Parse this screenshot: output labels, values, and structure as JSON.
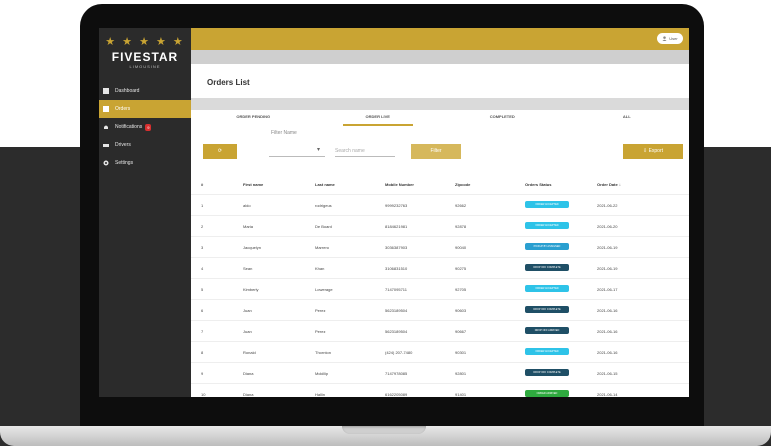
{
  "brand": {
    "stars": "★ ★ ★ ★ ★",
    "name": "FIVESTAR",
    "subtitle": "LIMOUSINE"
  },
  "sidebar": {
    "items": [
      {
        "label": "Dashboard",
        "icon": "grid-icon"
      },
      {
        "label": "Orders",
        "icon": "list-icon"
      },
      {
        "label": "Notifications",
        "icon": "bell-icon",
        "badge": "9"
      },
      {
        "label": "Drivers",
        "icon": "car-icon"
      },
      {
        "label": "Settings",
        "icon": "gear-icon"
      }
    ],
    "active_index": 1
  },
  "topbar": {
    "user_label": "User"
  },
  "page": {
    "title": "Orders List"
  },
  "tabs": [
    "ORDER PENDING",
    "ORDER LIVE",
    "COMPLETED",
    "ALL"
  ],
  "active_tab": 1,
  "filters": {
    "filter_label": "Filter Name",
    "search_placeholder": "Search name",
    "filter_button": "Filter",
    "export_button": "Export"
  },
  "table": {
    "headers": [
      "#",
      "First name",
      "Last name",
      "Mobile Number",
      "Zipcode",
      "Orders Status",
      "Order Date"
    ],
    "rows": [
      {
        "n": "1",
        "first": "aldo",
        "last": "rodrigeus",
        "mobile": "9999232763",
        "zip": "92662",
        "status": "ORDER ACCEPTED",
        "status_color": "#2ec3e8",
        "date": "2021-06-22"
      },
      {
        "n": "2",
        "first": "Maria",
        "last": "De Board",
        "mobile": "8184621981",
        "zip": "92878",
        "status": "ORDER ACCEPTED",
        "status_color": "#2ec3e8",
        "date": "2021-06-20"
      },
      {
        "n": "3",
        "first": "Jacquelyn",
        "last": "Marrero",
        "mobile": "3036387903",
        "zip": "90040",
        "status": "PICKUP BY ASSIGNED",
        "status_color": "#2a9fd0",
        "date": "2021-06-19"
      },
      {
        "n": "4",
        "first": "Sean",
        "last": "Khan",
        "mobile": "3106831510",
        "zip": "90275",
        "status": "DROP OFF COMPLETE",
        "status_color": "#1f4f66",
        "date": "2021-06-19"
      },
      {
        "n": "5",
        "first": "Kimberly",
        "last": "Lowerage",
        "mobile": "7147095711",
        "zip": "92705",
        "status": "ORDER ACCEPTED",
        "status_color": "#2ec3e8",
        "date": "2021-06-17"
      },
      {
        "n": "6",
        "first": "Juan",
        "last": "Perez",
        "mobile": "5623189504",
        "zip": "90603",
        "status": "DROP OFF COMPLETE",
        "status_color": "#1f4f66",
        "date": "2021-06-16"
      },
      {
        "n": "7",
        "first": "Juan",
        "last": "Perez",
        "mobile": "5623189504",
        "zip": "90667",
        "status": "DROP OFF ARRIVED",
        "status_color": "#1f4f66",
        "date": "2021-06-16"
      },
      {
        "n": "8",
        "first": "Ronald",
        "last": "Thornton",
        "mobile": "(424) 207-7480",
        "zip": "90301",
        "status": "ORDER ACCEPTED",
        "status_color": "#2ec3e8",
        "date": "2021-06-16"
      },
      {
        "n": "9",
        "first": "Diana",
        "last": "Mckillip",
        "mobile": "7147978085",
        "zip": "92801",
        "status": "DROP OFF COMPLETE",
        "status_color": "#1f4f66",
        "date": "2021-06-15"
      },
      {
        "n": "10",
        "first": "Diana",
        "last": "Hallin",
        "mobile": "6162205089",
        "zip": "91401",
        "status": "ORDER ARRIVED",
        "status_color": "#2faa3f",
        "date": "2021-06-14"
      }
    ]
  },
  "colors": {
    "accent": "#c9a433",
    "sidebar": "#2b2b2b"
  }
}
